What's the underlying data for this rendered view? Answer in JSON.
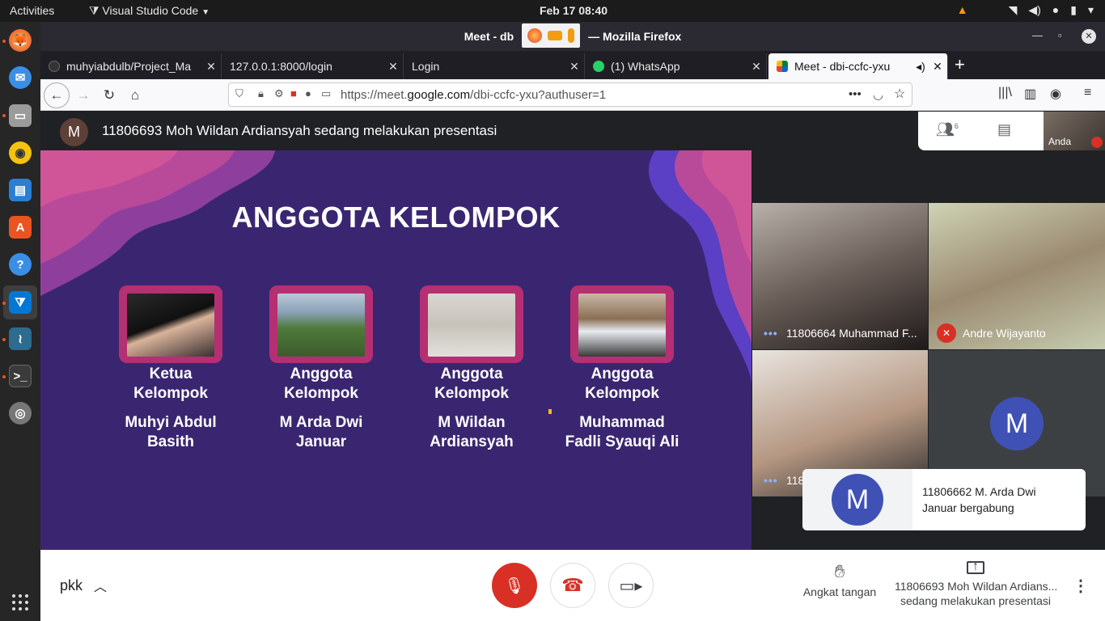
{
  "topbar": {
    "activities": "Activities",
    "app_name": "Visual Studio Code",
    "clock": "Feb 17  08:40"
  },
  "window": {
    "title_left": "Meet - db",
    "title_right": "— Mozilla Firefox"
  },
  "tabs": [
    {
      "label": "muhyiabdulb/Project_Ma",
      "favicon_color": "#333333"
    },
    {
      "label": "127.0.0.1:8000/login",
      "favicon_color": ""
    },
    {
      "label": "Login",
      "favicon_color": ""
    },
    {
      "label": "(1) WhatsApp",
      "favicon_color": "#25d366"
    },
    {
      "label": "Meet - dbi-ccfc-yxu",
      "favicon_color": "#00897b"
    }
  ],
  "address_bar": {
    "url_prefix": "https://meet.",
    "url_domain": "google.com",
    "url_path": "/dbi-ccfc-yxu?authuser=1"
  },
  "meet": {
    "presenter_avatar": "M",
    "presenter_text": "11806693 Moh Wildan Ardiansyah sedang melakukan presentasi",
    "participants_count": "6",
    "self_label": "Anda",
    "meeting_name": "pkk",
    "raise_hand_label": "Angkat tangan",
    "presenting_line1": "11806693 Moh Wildan Ardians...",
    "presenting_line2": "sedang melakukan presentasi"
  },
  "slide": {
    "title": "ANGGOTA KELOMPOK",
    "members": [
      {
        "role": "Ketua\nKelompok",
        "role_l1": "Ketua",
        "role_l2": "Kelompok",
        "name_l1": "Muhyi Abdul",
        "name_l2": "Basith"
      },
      {
        "role_l1": "Anggota",
        "role_l2": "Kelompok",
        "name_l1": "M Arda Dwi",
        "name_l2": "Januar"
      },
      {
        "role_l1": "Anggota",
        "role_l2": "Kelompok",
        "name_l1": "M Wildan",
        "name_l2": "Ardiansyah"
      },
      {
        "role_l1": "Anggota",
        "role_l2": "Kelompok",
        "name_l1": "Muhammad",
        "name_l2": "Fadli Syauqi Ali"
      }
    ]
  },
  "participants": [
    {
      "name": "11806664 Muhammad F...",
      "status": "speaking"
    },
    {
      "name": "Andre Wijayanto",
      "status": "muted"
    },
    {
      "name": "118",
      "status": "speaking"
    },
    {
      "name": "",
      "avatar": "M"
    }
  ],
  "toast": {
    "avatar": "M",
    "message": "11806662 M. Arda Dwi Januar bergabung"
  },
  "colors": {
    "slide_bg": "#3a2670",
    "accent_pink": "#b52f73",
    "end_call_red": "#d93025",
    "avatar_blue": "#3f51b5"
  }
}
